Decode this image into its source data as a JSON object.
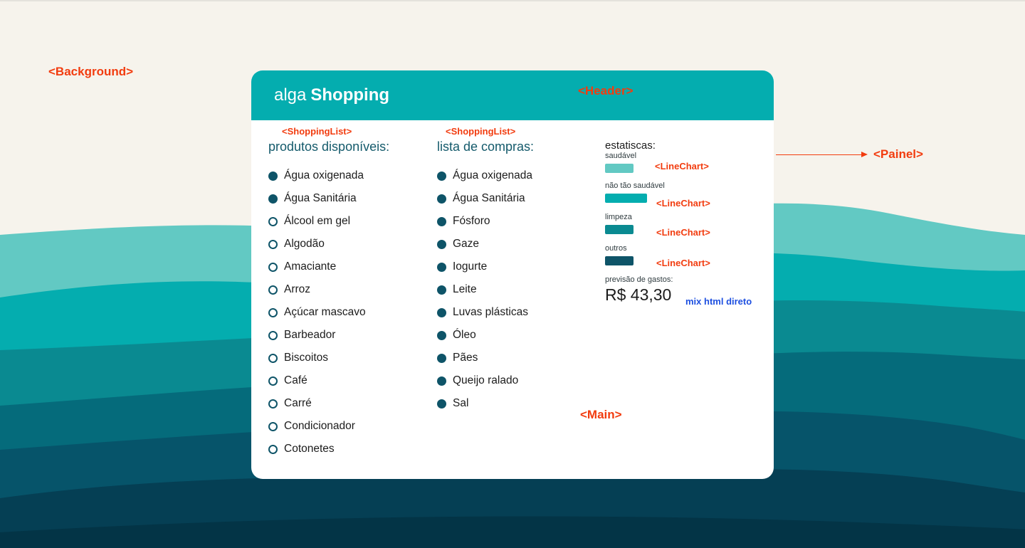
{
  "colors": {
    "background": "#f6f3ec",
    "header": "#04adaf",
    "annotation": "#f23c0f",
    "note": "#1d4fe0",
    "dot": "#0e5468",
    "waves": [
      "#62c9c3",
      "#04adaf",
      "#0a8a91",
      "#056b7b",
      "#06546a",
      "#053f54",
      "#033446"
    ]
  },
  "annotations": {
    "background": "<Background>",
    "header": "<Header>",
    "painel": "<Painel>",
    "shopping_list_1": "<ShoppingList>",
    "shopping_list_2": "<ShoppingList>",
    "line_chart": "<LineChart>",
    "main": "<Main>"
  },
  "header": {
    "logo_light": "alga",
    "logo_bold": "Shopping"
  },
  "available": {
    "title": "produtos disponíveis:",
    "items": [
      {
        "label": "Água oxigenada",
        "selected": true
      },
      {
        "label": "Água Sanitária",
        "selected": true
      },
      {
        "label": "Álcool em gel",
        "selected": false
      },
      {
        "label": "Algodão",
        "selected": false
      },
      {
        "label": "Amaciante",
        "selected": false
      },
      {
        "label": "Arroz",
        "selected": false
      },
      {
        "label": "Açúcar mascavo",
        "selected": false
      },
      {
        "label": "Barbeador",
        "selected": false
      },
      {
        "label": "Biscoitos",
        "selected": false
      },
      {
        "label": "Café",
        "selected": false
      },
      {
        "label": "Carré",
        "selected": false
      },
      {
        "label": "Condicionador",
        "selected": false
      },
      {
        "label": "Cotonetes",
        "selected": false
      }
    ]
  },
  "shopping": {
    "title": "lista de compras:",
    "items": [
      {
        "label": "Água oxigenada",
        "selected": true
      },
      {
        "label": "Água Sanitária",
        "selected": true
      },
      {
        "label": "Fósforo",
        "selected": true
      },
      {
        "label": "Gaze",
        "selected": true
      },
      {
        "label": "Iogurte",
        "selected": true
      },
      {
        "label": "Leite",
        "selected": true
      },
      {
        "label": "Luvas plásticas",
        "selected": true
      },
      {
        "label": "Óleo",
        "selected": true
      },
      {
        "label": "Pães",
        "selected": true
      },
      {
        "label": "Queijo ralado",
        "selected": true
      },
      {
        "label": "Sal",
        "selected": true
      }
    ]
  },
  "stats": {
    "title": "estatiscas:",
    "rows": [
      {
        "label": "saudável",
        "fraction": 0.18,
        "color": "#62c9c3"
      },
      {
        "label": "não tão saudável",
        "fraction": 0.27,
        "color": "#04adaf"
      },
      {
        "label": "limpeza",
        "fraction": 0.18,
        "color": "#0a8a91"
      },
      {
        "label": "outros",
        "fraction": 0.18,
        "color": "#0e5468"
      }
    ],
    "forecast_label": "previsão de gastos:",
    "forecast_value": "R$ 43,30",
    "note": "mix html direto"
  }
}
